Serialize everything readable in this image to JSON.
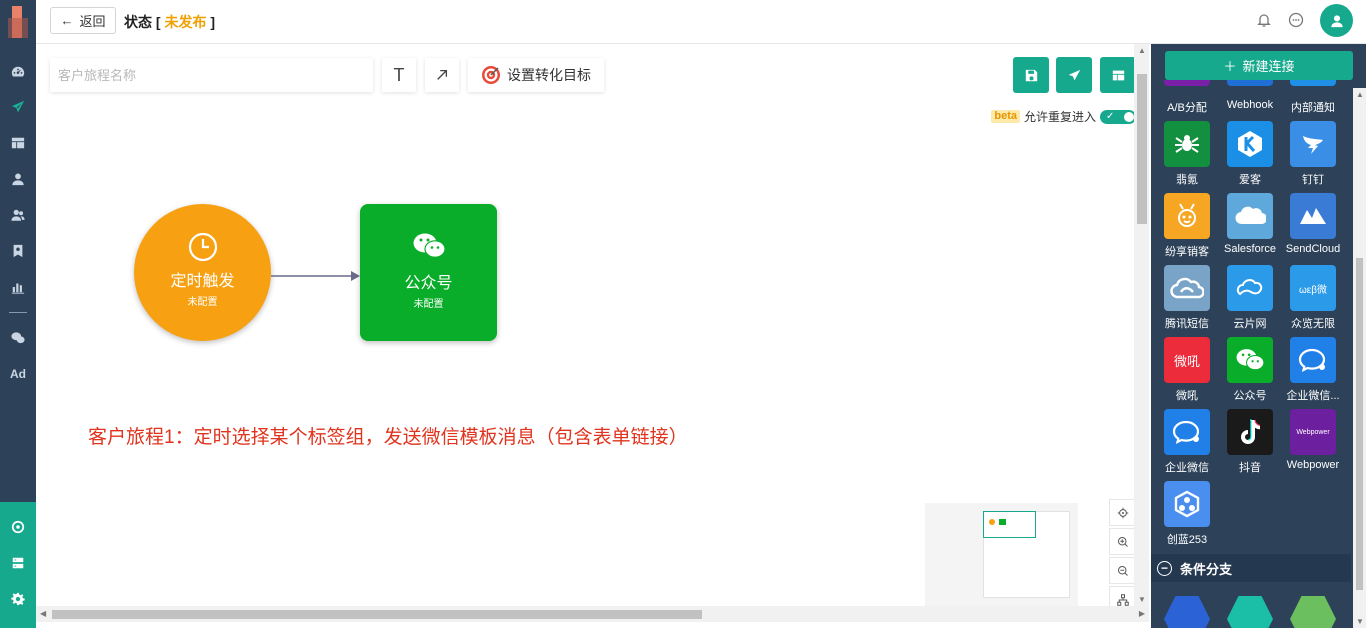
{
  "topbar": {
    "back_label": "返回",
    "status_label": "状态 [",
    "status_value": "未发布",
    "status_close": "]"
  },
  "toolbar": {
    "name_placeholder": "客户旅程名称",
    "text_tool": "T",
    "goal_label": "设置转化目标"
  },
  "options": {
    "beta_badge": "beta",
    "allow_reentry": "允许重复进入",
    "allow_reentry_on": true
  },
  "nodes": [
    {
      "title": "定时触发",
      "status": "未配置",
      "color": "#f7a012",
      "icon": "clock-icon"
    },
    {
      "title": "公众号",
      "status": "未配置",
      "color": "#09ad2a",
      "icon": "wechat-icon"
    }
  ],
  "annotation": "客户旅程1：定时选择某个标签组，发送微信模板消息（包含表单链接）",
  "panel": {
    "new_connection": "新建连接",
    "top_row": [
      "A/B分配",
      "Webhook",
      "内部通知"
    ],
    "tiles": [
      {
        "label": "翡氪",
        "color": "#128f3f",
        "icon": "spider-icon"
      },
      {
        "label": "爱客",
        "color": "#1b8fe6",
        "icon": "k-icon"
      },
      {
        "label": "钉钉",
        "color": "#3a8ee6",
        "icon": "dingtalk-icon"
      },
      {
        "label": "纷享销客",
        "color": "#f7a623",
        "icon": "bee-icon"
      },
      {
        "label": "Salesforce",
        "color": "#5ea8dc",
        "icon": "cloud-icon"
      },
      {
        "label": "SendCloud",
        "color": "#3a7bd5",
        "icon": "sendcloud-icon"
      },
      {
        "label": "腾讯短信",
        "color": "#7aa3c8",
        "icon": "cloud-outline-icon"
      },
      {
        "label": "云片网",
        "color": "#2b9ae8",
        "icon": "yunpian-icon"
      },
      {
        "label": "众览无限",
        "color": "#2b9ae8",
        "icon": "wei-icon"
      },
      {
        "label": "微吼",
        "color": "#ec2b3b",
        "icon": "vhall-icon"
      },
      {
        "label": "公众号",
        "color": "#09ad2a",
        "icon": "wechat-icon"
      },
      {
        "label": "企业微信...",
        "color": "#2180e8",
        "icon": "wecom-icon"
      },
      {
        "label": "企业微信",
        "color": "#2180e8",
        "icon": "wecom-icon"
      },
      {
        "label": "抖音",
        "color": "#1a1a1a",
        "icon": "tiktok-icon"
      },
      {
        "label": "Webpower",
        "color": "#6c1f9e",
        "icon": "webpower-icon"
      },
      {
        "label": "创蓝253",
        "color": "#4a8ef0",
        "icon": "chuanglan-icon"
      }
    ],
    "tile_texts": {
      "vhall": "微吼",
      "wei": "ωεβ微",
      "webpower": "Webpower"
    },
    "branch_label": "条件分支"
  },
  "colors": {
    "accent": "#17a98e",
    "nav_bg": "#2d4259",
    "annotation": "#e0341e",
    "status": "#f0a000"
  }
}
